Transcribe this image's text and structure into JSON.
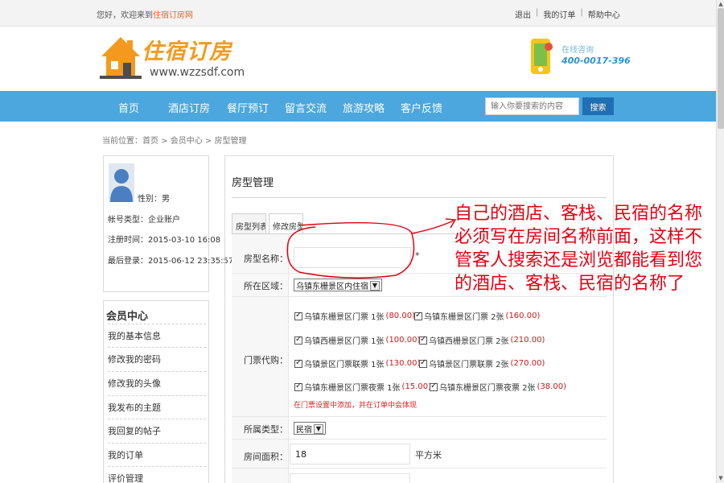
{
  "topbar": {
    "welcome_prefix": "您好，欢迎来到",
    "site_name": "住宿订房网",
    "links": [
      "退出",
      "我的订单",
      "帮助中心"
    ],
    "separator": "|"
  },
  "header": {
    "logo_text": "住宿订房",
    "logo_url": "www.wzzsdf.com",
    "consult_label": "在线咨询",
    "consult_phone": "400-0017-396"
  },
  "nav": {
    "items": [
      "首页",
      "酒店订房",
      "餐厅预订",
      "留言交流",
      "旅游攻略",
      "客户反馈"
    ],
    "search_placeholder": "输入你要搜索的内容",
    "search_button": "搜索"
  },
  "breadcrumb": "当前位置：首页 > 会员中心 > 房型管理",
  "profile": {
    "gender": "性别：男",
    "account_type": "帐号类型：企业账户",
    "register_time": "注册时间：2015-03-10 16:08",
    "last_login": "最后登录：2015-06-12 23:35:57"
  },
  "member_center": {
    "title": "会员中心",
    "items": [
      "我的基本信息",
      "修改我的密码",
      "修改我的头像",
      "我发布的主题",
      "我回复的帖子",
      "我的订单",
      "评价管理"
    ]
  },
  "main": {
    "title": "房型管理",
    "tabs": [
      "房型列表",
      "修改房型"
    ],
    "form": {
      "room_name_label": "房型名称：",
      "room_name_value": "",
      "required_mark": "*",
      "area_label": "所在区域：",
      "area_value": "乌镇东栅景区内住宿",
      "tickets_label": "门票代购：",
      "tickets": [
        {
          "name": "乌镇东栅景区门票 1张",
          "price": "(80.00)"
        },
        {
          "name": "乌镇东栅景区门票 2张",
          "price": "(160.00)"
        },
        {
          "name": "乌镇西栅景区门票 1张",
          "price": "(100.00)"
        },
        {
          "name": "乌镇西栅景区门票 2张",
          "price": "(210.00)"
        },
        {
          "name": "乌镇景区门票联票 1张",
          "price": "(130.00)"
        },
        {
          "name": "乌镇景区门票联票 2张",
          "price": "(270.00)"
        },
        {
          "name": "乌镇东栅景区门票夜票 1张",
          "price": "(15.00)"
        },
        {
          "name": "乌镇东栅景区门票夜票 2张",
          "price": "(38.00)"
        }
      ],
      "tickets_note": "在门票设置中添加，并在订单中会体现",
      "type_label": "所属类型：",
      "type_value": "民宿",
      "room_area_label": "房间面积：",
      "room_area_value": "18",
      "room_area_unit": "平方米"
    }
  },
  "annotation": "自己的酒店、客栈、民宿的名称必须写在房间名称前面，这样不管客人搜索还是浏览都能看到您的酒店、客栈、民宿的名称了",
  "colors": {
    "nav_bg": "#4ba7de",
    "logo_orange": "#f39a1e",
    "annotation_red": "#e60012",
    "price_red": "#c81b1b"
  }
}
